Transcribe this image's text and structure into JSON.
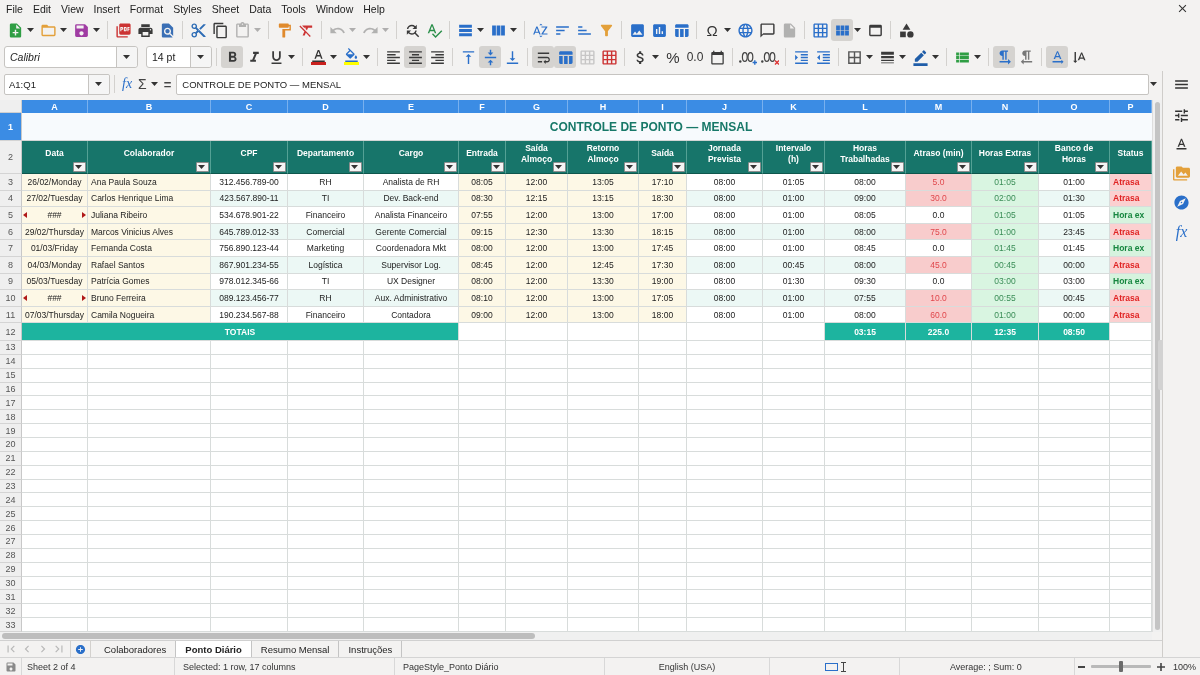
{
  "menu_bar": {
    "items": [
      "File",
      "Edit",
      "View",
      "Insert",
      "Format",
      "Styles",
      "Sheet",
      "Data",
      "Tools",
      "Window",
      "Help"
    ]
  },
  "standard_toolbar": {
    "paste_disabled": true,
    "undo_disabled": true,
    "redo_disabled": true,
    "special_character": "Ω",
    "header_footer_disabled": true,
    "freeze_on": true
  },
  "formatting_toolbar": {
    "font_name": "Calibri",
    "font_missing": true,
    "font_size": "14 pt",
    "bold": true,
    "italic": false,
    "underline": false,
    "align_left": false,
    "align_center": true,
    "align_right": false,
    "align_top": false,
    "align_middle": true,
    "align_bottom": false,
    "wrap_text": true,
    "merge_center": true,
    "merge_disabled": true,
    "percent": "%",
    "decimal_format": "0.0",
    "ltr": true,
    "rtl": false,
    "horizontal_text": true,
    "vertical_text": false
  },
  "formula_bar": {
    "name_box": "A1:Q1",
    "function_wizard": "fx",
    "sum": "Σ",
    "equals": "=",
    "content": "CONTROLE DE PONTO — MENSAL"
  },
  "sheet": {
    "column_letters": [
      {
        "label": "A",
        "selected": true
      },
      {
        "label": "B",
        "selected": true
      },
      {
        "label": "C",
        "selected": true
      },
      {
        "label": "D",
        "selected": true
      },
      {
        "label": "E",
        "selected": true
      },
      {
        "label": "F",
        "selected": true
      },
      {
        "label": "G",
        "selected": true
      },
      {
        "label": "H",
        "selected": true
      },
      {
        "label": "I",
        "selected": true
      },
      {
        "label": "J",
        "selected": true
      },
      {
        "label": "K",
        "selected": true
      },
      {
        "label": "L",
        "selected": true
      },
      {
        "label": "M",
        "selected": true
      },
      {
        "label": "N",
        "selected": true
      },
      {
        "label": "O",
        "selected": true
      },
      {
        "label": "P",
        "selected": true
      }
    ],
    "row_numbers": [
      {
        "label": "1",
        "selected": true
      },
      {
        "label": "2",
        "selected": false
      },
      {
        "label": "3",
        "selected": false
      },
      {
        "label": "4",
        "selected": false
      },
      {
        "label": "5",
        "selected": false
      },
      {
        "label": "6",
        "selected": false
      },
      {
        "label": "7",
        "selected": false
      },
      {
        "label": "8",
        "selected": false
      },
      {
        "label": "9",
        "selected": false
      },
      {
        "label": "10",
        "selected": false
      },
      {
        "label": "11",
        "selected": false
      },
      {
        "label": "12",
        "selected": false
      },
      {
        "label": "13",
        "selected": false
      },
      {
        "label": "14",
        "selected": false
      },
      {
        "label": "15",
        "selected": false
      },
      {
        "label": "16",
        "selected": false
      },
      {
        "label": "17",
        "selected": false
      },
      {
        "label": "18",
        "selected": false
      },
      {
        "label": "19",
        "selected": false
      },
      {
        "label": "20",
        "selected": false
      },
      {
        "label": "21",
        "selected": false
      },
      {
        "label": "22",
        "selected": false
      },
      {
        "label": "23",
        "selected": false
      },
      {
        "label": "24",
        "selected": false
      },
      {
        "label": "25",
        "selected": false
      },
      {
        "label": "26",
        "selected": false
      },
      {
        "label": "27",
        "selected": false
      },
      {
        "label": "28",
        "selected": false
      },
      {
        "label": "29",
        "selected": false
      },
      {
        "label": "30",
        "selected": false
      },
      {
        "label": "31",
        "selected": false
      },
      {
        "label": "32",
        "selected": false
      },
      {
        "label": "33",
        "selected": false
      }
    ],
    "title": "CONTROLE DE PONTO — MENSAL",
    "headers": [
      {
        "label": "Data",
        "filter": true
      },
      {
        "label": "Colaborador",
        "filter": true
      },
      {
        "label": "CPF",
        "filter": true
      },
      {
        "label": "Departamento",
        "filter": true
      },
      {
        "label": "Cargo",
        "filter": true
      },
      {
        "label": "Entrada",
        "filter": true
      },
      {
        "label": "Saída Almoço",
        "filter": true
      },
      {
        "label": "Retorno Almoço",
        "filter": true
      },
      {
        "label": "Saída",
        "filter": true
      },
      {
        "label": "Jornada Prevista",
        "filter": true
      },
      {
        "label": "Intervalo (h)",
        "filter": true
      },
      {
        "label": "Horas Trabalhadas",
        "filter": true
      },
      {
        "label": "Atraso (min)",
        "filter": true
      },
      {
        "label": "Horas Extras",
        "filter": true
      },
      {
        "label": "Banco de Horas",
        "filter": true
      },
      {
        "label": "Status",
        "filter": false
      }
    ],
    "rows": [
      {
        "date": "26/02/Monday",
        "date_overflow": false,
        "name": "Ana Paula Souza",
        "cpf": "312.456.789-00",
        "department": "RH",
        "role": "Analista de RH",
        "entry": "08:05",
        "lunch_out": "12:00",
        "lunch_return": "13:05",
        "exit": "17:10",
        "planned": "08:00",
        "break": "01:05",
        "worked": "08:00",
        "delay": "5.0",
        "overtime": "01:05",
        "bank": "01:00",
        "status": "Atrasa",
        "late": true
      },
      {
        "date": "27/02/Tuesday",
        "date_overflow": false,
        "name": "Carlos Henrique Lima",
        "cpf": "423.567.890-11",
        "department": "TI",
        "role": "Dev. Back-end",
        "entry": "08:30",
        "lunch_out": "12:15",
        "lunch_return": "13:15",
        "exit": "18:30",
        "planned": "08:00",
        "break": "01:00",
        "worked": "09:00",
        "delay": "30.0",
        "overtime": "02:00",
        "bank": "01:30",
        "status": "Atrasa",
        "late": true
      },
      {
        "date": "###",
        "date_overflow": true,
        "name": "Juliana Ribeiro",
        "cpf": "534.678.901-22",
        "department": "Financeiro",
        "role": "Analista Financeiro",
        "entry": "07:55",
        "lunch_out": "12:00",
        "lunch_return": "13:00",
        "exit": "17:00",
        "planned": "08:00",
        "break": "01:00",
        "worked": "08:05",
        "delay": "0.0",
        "overtime": "01:05",
        "bank": "01:05",
        "status": "Hora ex",
        "late": false
      },
      {
        "date": "29/02/Thursday",
        "date_overflow": false,
        "name": "Marcos Vinicius Alves",
        "cpf": "645.789.012-33",
        "department": "Comercial",
        "role": "Gerente Comercial",
        "entry": "09:15",
        "lunch_out": "12:30",
        "lunch_return": "13:30",
        "exit": "18:15",
        "planned": "08:00",
        "break": "01:00",
        "worked": "08:00",
        "delay": "75.0",
        "overtime": "01:00",
        "bank": "23:45",
        "status": "Atrasa",
        "late": true
      },
      {
        "date": "01/03/Friday",
        "date_overflow": false,
        "name": "Fernanda Costa",
        "cpf": "756.890.123-44",
        "department": "Marketing",
        "role": "Coordenadora Mkt",
        "entry": "08:00",
        "lunch_out": "12:00",
        "lunch_return": "13:00",
        "exit": "17:45",
        "planned": "08:00",
        "break": "01:00",
        "worked": "08:45",
        "delay": "0.0",
        "overtime": "01:45",
        "bank": "01:45",
        "status": "Hora ex",
        "late": false
      },
      {
        "date": "04/03/Monday",
        "date_overflow": false,
        "name": "Rafael Santos",
        "cpf": "867.901.234-55",
        "department": "Logística",
        "role": "Supervisor Log.",
        "entry": "08:45",
        "lunch_out": "12:00",
        "lunch_return": "12:45",
        "exit": "17:30",
        "planned": "08:00",
        "break": "00:45",
        "worked": "08:00",
        "delay": "45.0",
        "overtime": "00:45",
        "bank": "00:00",
        "status": "Atrasa",
        "late": true
      },
      {
        "date": "05/03/Tuesday",
        "date_overflow": false,
        "name": "Patrícia Gomes",
        "cpf": "978.012.345-66",
        "department": "TI",
        "role": "UX Designer",
        "entry": "08:00",
        "lunch_out": "12:00",
        "lunch_return": "13:30",
        "exit": "19:00",
        "planned": "08:00",
        "break": "01:30",
        "worked": "09:30",
        "delay": "0.0",
        "overtime": "03:00",
        "bank": "03:00",
        "status": "Hora ex",
        "late": false
      },
      {
        "date": "###",
        "date_overflow": true,
        "name": "Bruno Ferreira",
        "cpf": "089.123.456-77",
        "department": "RH",
        "role": "Aux. Administrativo",
        "entry": "08:10",
        "lunch_out": "12:00",
        "lunch_return": "13:00",
        "exit": "17:05",
        "planned": "08:00",
        "break": "01:00",
        "worked": "07:55",
        "delay": "10.0",
        "overtime": "00:55",
        "bank": "00:45",
        "status": "Atrasa",
        "late": true
      },
      {
        "date": "07/03/Thursday",
        "date_overflow": false,
        "name": "Camila Nogueira",
        "cpf": "190.234.567-88",
        "department": "Financeiro",
        "role": "Contadora",
        "entry": "09:00",
        "lunch_out": "12:00",
        "lunch_return": "13:00",
        "exit": "18:00",
        "planned": "08:00",
        "break": "01:00",
        "worked": "08:00",
        "delay": "60.0",
        "overtime": "01:00",
        "bank": "00:00",
        "status": "Atrasa",
        "late": true
      }
    ],
    "totals": {
      "label": "TOTAIS",
      "worked": "03:15",
      "delay": "225.0",
      "overtime": "12:35",
      "bank": "08:50"
    }
  },
  "sidebar": {
    "functions": "fx"
  },
  "sheet_tabs": [
    {
      "label": "Colaboradores",
      "selected": false
    },
    {
      "label": "Ponto Diário",
      "selected": true
    },
    {
      "label": "Resumo Mensal",
      "selected": false
    },
    {
      "label": "Instruções",
      "selected": false
    }
  ],
  "status_bar": {
    "sheet": "Sheet 2 of 4",
    "selection": "Selected: 1 row, 17 columns",
    "page_style": "PageStyle_Ponto Diário",
    "language": "English (USA)",
    "summary": "Average: ; Sum: 0",
    "zoom": {
      "level": 0.5,
      "reading": "100%"
    }
  }
}
